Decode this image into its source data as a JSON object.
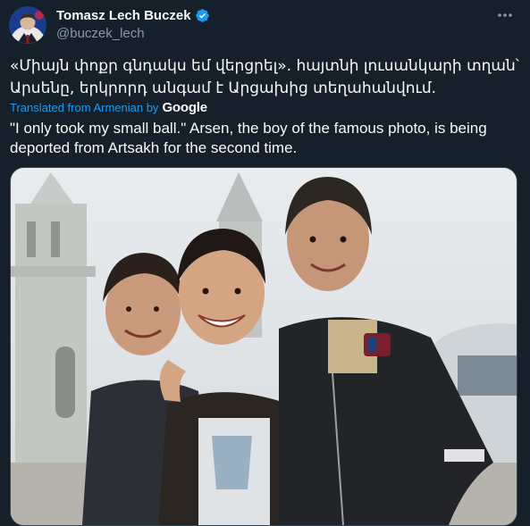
{
  "author": {
    "display_name": "Tomasz Lech Buczek",
    "handle": "@buczek_lech",
    "verified": true,
    "avatar_icon": "avatar-portrait"
  },
  "tweet": {
    "original_text": "«Միայն փոքր գնդակս եմ վերցրել». հայտնի լուսանկարի տղան՝ Արսենը, երկրորդ անգամ է Արցախից տեղահանվում.",
    "translated_label": "Translated from Armenian by",
    "translated_provider": "Google",
    "translated_text": "\"I only took my small ball.\" Arsen, the boy of the famous photo, is being deported from Artsakh for the second time."
  },
  "media": {
    "description_icon": "photo-three-boys"
  },
  "colors": {
    "background": "#15202b",
    "accent": "#1d9bf0",
    "secondary_text": "#8b98a5",
    "primary_text": "#f7f9f9"
  },
  "icons": {
    "more": "more-horizontal-icon",
    "verified": "verified-badge-icon"
  }
}
